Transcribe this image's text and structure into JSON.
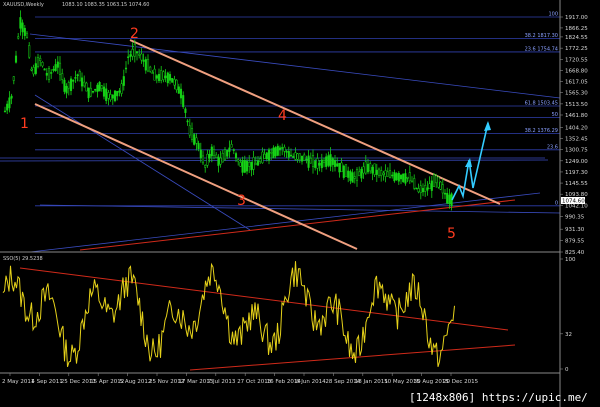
{
  "window": {
    "symbol_header": "XAUUSD,Weekly",
    "ohlc_header": "1083.10 1083.35 1063.15 1074.60",
    "indicator_header": "SSO(5) 29.5238",
    "watermark": "[1248x806] https://upic.me/"
  },
  "chart_data": [
    {
      "type": "candlestick",
      "title": "XAUUSD,Weekly",
      "price_axis_labels": [
        "1917.00",
        "1866.25",
        "1824.55",
        "1772.25",
        "1720.55",
        "1668.80",
        "1617.05",
        "1565.30",
        "1513.50",
        "1461.80",
        "1404.20",
        "1352.45",
        "1300.75",
        "1249.00",
        "1197.30",
        "1145.55",
        "1093.80",
        "1042.10",
        "990.35",
        "931.30",
        "879.55",
        "825.40"
      ],
      "current_price": "1074.60",
      "time_axis_labels": [
        "2 May 2011",
        "4 Sep 2011",
        "25 Dec 2011",
        "15 Apr 2012",
        "5 Aug 2012",
        "25 Nov 2012",
        "17 Mar 2013",
        "7 Jul 2013",
        "27 Oct 2013",
        "16 Feb 2014",
        "8 Jun 2014",
        "28 Sep 2014",
        "18 Jan 2015",
        "10 May 2015",
        "30 Aug 2015",
        "20 Dec 2015"
      ],
      "series_color": "#16d316",
      "fib_levels": [
        {
          "label": "100",
          "price": 1917.0
        },
        {
          "label": "38.2 1817.30",
          "price": 1817.3
        },
        {
          "label": "23.6 1754.74",
          "price": 1754.74
        },
        {
          "label": "61.8 1503.45",
          "price": 1503.45
        },
        {
          "label": "50",
          "price": 1450.0
        },
        {
          "label": "38.2 1376.29",
          "price": 1376.29
        },
        {
          "label": "23.6",
          "price": 1300.0
        },
        {
          "label": "0",
          "price": 1040.0
        }
      ],
      "wave_labels": [
        "1",
        "2",
        "3",
        "4",
        "5"
      ],
      "projection_color": "#33ccff",
      "channel_color": "#f0a080"
    },
    {
      "type": "line",
      "name": "SSO(5)",
      "value": "29.5238",
      "axis_labels": [
        "100",
        "32",
        "0"
      ],
      "series_color": "#e6d21a",
      "trendline_color": "#d02a1a"
    }
  ]
}
